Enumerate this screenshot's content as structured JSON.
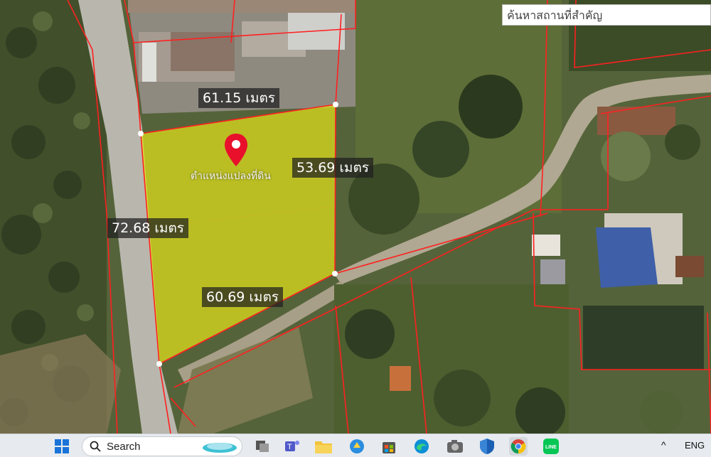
{
  "search": {
    "placeholder": "ค้นหาสถานที่สำคัญ"
  },
  "parcel": {
    "name": "ตำแหน่งแปลงที่ดิน",
    "edges": [
      {
        "id": "top",
        "label": "61.15 เมตร"
      },
      {
        "id": "right",
        "label": "53.69 เมตร"
      },
      {
        "id": "left",
        "label": "72.68 เมตร"
      },
      {
        "id": "bottom",
        "label": "60.69 เมตร"
      }
    ],
    "fill_color": "#e2e21a",
    "boundary_color": "#ff2020",
    "pin_color": "#e8102a"
  },
  "taskbar": {
    "search_label": "Search",
    "language": "ENG",
    "tray_chevron": "^",
    "apps": [
      "windows-start-icon",
      "search-icon",
      "task-view-icon",
      "teams-icon",
      "file-explorer-icon",
      "copilot-icon",
      "microsoft-store-icon",
      "edge-icon",
      "camera-icon",
      "defender-icon",
      "chrome-icon",
      "line-icon"
    ]
  }
}
